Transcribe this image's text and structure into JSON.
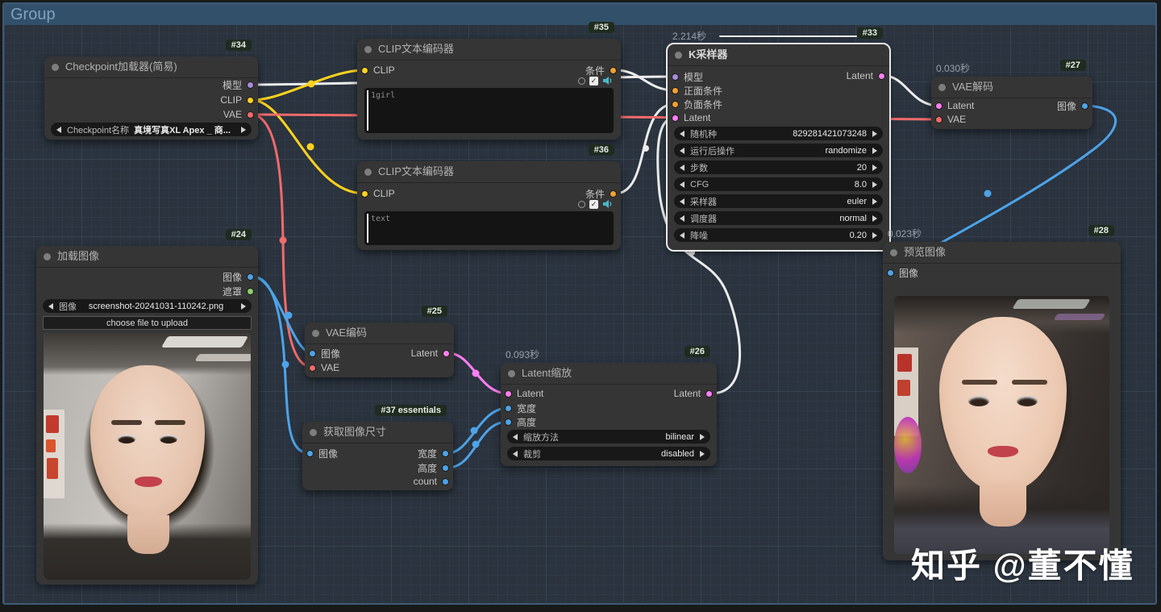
{
  "group": {
    "label": "Group"
  },
  "watermark": {
    "text": "知乎 @董不懂"
  },
  "icons": {
    "check": "✓"
  },
  "colors": {
    "model": "#a78bdb",
    "clip": "#ffd21e",
    "vae": "#f16a6a",
    "conditioning": "#f0a132",
    "latent": "#ff7ef2",
    "image": "#4da3e8",
    "mask": "#8ed06c",
    "active_wire": "#ececec"
  },
  "nodes": {
    "checkpoint": {
      "badge": "#34",
      "title": "Checkpoint加载器(简易)",
      "outputs": {
        "model": "模型",
        "clip": "CLIP",
        "vae": "VAE"
      },
      "widget": {
        "name": "Checkpoint名称",
        "value": "真境写真XL Apex _ 商..."
      }
    },
    "clip_positive": {
      "badge": "#35",
      "title": "CLIP文本编码器",
      "input": "CLIP",
      "output": "条件",
      "text": "1girl"
    },
    "clip_negative": {
      "badge": "#36",
      "title": "CLIP文本编码器",
      "input": "CLIP",
      "output": "条件",
      "text": "text"
    },
    "ksampler": {
      "badge": "#33",
      "time": "2.214秒",
      "title": "K采样器",
      "inputs": [
        "模型",
        "正面条件",
        "负面条件",
        "Latent"
      ],
      "output": "Latent",
      "widgets": [
        {
          "name": "随机种",
          "value": "829281421073248"
        },
        {
          "name": "运行后操作",
          "value": "randomize"
        },
        {
          "name": "步数",
          "value": "20"
        },
        {
          "name": "CFG",
          "value": "8.0"
        },
        {
          "name": "采样器",
          "value": "euler"
        },
        {
          "name": "调度器",
          "value": "normal"
        },
        {
          "name": "降噪",
          "value": "0.20"
        }
      ]
    },
    "vae_decode": {
      "badge": "#27",
      "time": "0.030秒",
      "title": "VAE解码",
      "inputs": [
        "Latent",
        "VAE"
      ],
      "output": "图像"
    },
    "load_image": {
      "badge": "#24",
      "title": "加载图像",
      "outputs": [
        "图像",
        "遮罩"
      ],
      "widget": {
        "name": "图像",
        "value": "screenshot-20241031-110242.png"
      },
      "upload_button": "choose file to upload"
    },
    "vae_encode": {
      "badge": "#25",
      "title": "VAE编码",
      "inputs": [
        "图像",
        "VAE"
      ],
      "output": "Latent"
    },
    "get_image_size": {
      "badge": "#37 essentials",
      "title": "获取图像尺寸",
      "input": "图像",
      "outputs": [
        "宽度",
        "高度",
        "count"
      ]
    },
    "latent_scale": {
      "badge": "#26",
      "time": "0.093秒",
      "title": "Latent缩放",
      "inputs": [
        "Latent",
        "宽度",
        "高度"
      ],
      "output": "Latent",
      "widgets": [
        {
          "name": "缩放方法",
          "value": "bilinear"
        },
        {
          "name": "裁剪",
          "value": "disabled"
        }
      ]
    },
    "preview_image": {
      "badge": "#28",
      "time": "0.023秒",
      "title": "预览图像",
      "input": "图像"
    }
  }
}
